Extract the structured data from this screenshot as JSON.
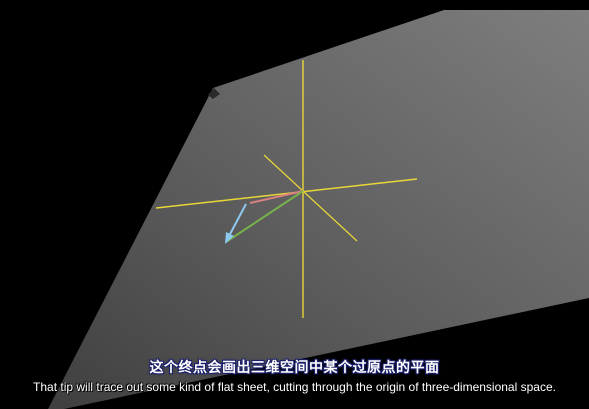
{
  "subtitles": {
    "chinese": "这个终点会画出三维空间中某个过原点的平面",
    "english": "That tip will trace out some kind of flat sheet, cutting through the origin of three-dimensional space."
  },
  "colors": {
    "background": "#000000",
    "plane_light": "#7b7b7b",
    "plane_dark": "#4a4a4a",
    "axis": "#e8d63a",
    "vector_blue": "#8ec9ee",
    "vector_green": "#78b04a",
    "vector_red": "#d98080",
    "subtitle_outline": "#1a1f6b"
  }
}
